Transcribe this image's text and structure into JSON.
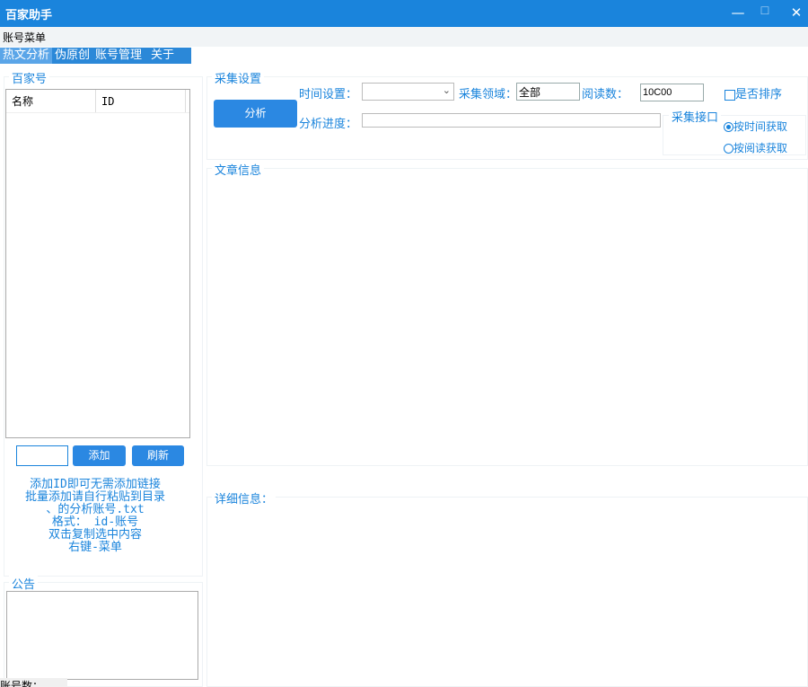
{
  "window": {
    "title": "百家助手"
  },
  "menu": {
    "account_menu": "账号菜单"
  },
  "tabs": [
    {
      "label": "热文分析",
      "selected": true
    },
    {
      "label": "伪原创"
    },
    {
      "label": "账号管理"
    },
    {
      "label": "关于"
    }
  ],
  "left": {
    "group_title": "百家号",
    "columns": [
      "名称",
      "ID"
    ],
    "id_input": "",
    "add_label": "添加",
    "refresh_label": "刷新",
    "help_lines": [
      "添加ID即可无需添加链接",
      "批量添加请自行粘贴到目录",
      "、的分析账号.txt",
      "格式：  id-账号",
      "双击复制选中内容",
      "右键-菜单"
    ],
    "notice_title": "公告",
    "notice_text": ""
  },
  "collect": {
    "group_title": "采集设置",
    "analyze_label": "分析",
    "time_label": "时间设置：",
    "time_value": "",
    "field_label": "采集领域：",
    "field_value": "全部",
    "reads_label": "阅读数：",
    "reads_value": "10C00",
    "sort_label": "是否排序",
    "sort_checked": false,
    "progress_label": "分析进度：",
    "progress": 0,
    "api_title": "采集接口",
    "radio_time": "按时间获取",
    "radio_read": "按阅读获取",
    "radio_selected": "按时间获取"
  },
  "articles": {
    "group_title": "文章信息"
  },
  "detail": {
    "label": "详细信息："
  },
  "status": {
    "account_count": "账号数："
  },
  "colors": {
    "accent": "#1a84dc",
    "button": "#2b88e2"
  }
}
